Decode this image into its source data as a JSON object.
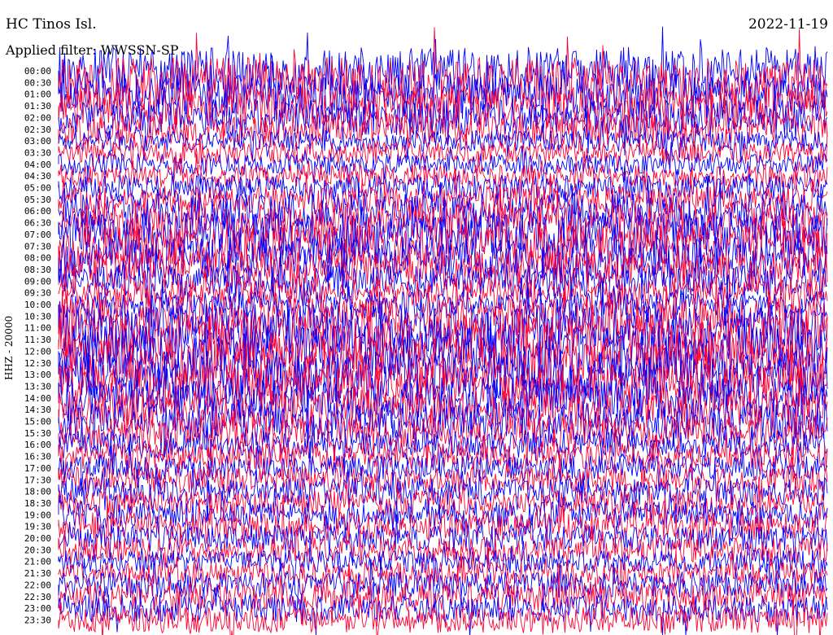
{
  "header": {
    "station": "HC Tinos Isl.",
    "date": "2022-11-19",
    "filter": "Applied filter: WWSSN-SP"
  },
  "channel_label": "HHZ - 20000",
  "colors": {
    "trace_a": "#0000ff",
    "trace_b": "#ff0033",
    "background": "#ffffff"
  },
  "chart_data": {
    "type": "line",
    "title": "HC Tinos Isl.",
    "ylabel": "HHZ - 20000",
    "row_labels": [
      "00:00",
      "00:30",
      "01:00",
      "01:30",
      "02:00",
      "02:30",
      "03:00",
      "03:30",
      "04:00",
      "04:30",
      "05:00",
      "05:30",
      "06:00",
      "06:30",
      "07:00",
      "07:30",
      "08:00",
      "08:30",
      "09:00",
      "09:30",
      "10:00",
      "10:30",
      "11:00",
      "11:30",
      "12:00",
      "12:30",
      "13:00",
      "13:30",
      "14:00",
      "14:30",
      "15:00",
      "15:30",
      "16:00",
      "16:30",
      "17:00",
      "17:30",
      "18:00",
      "18:30",
      "19:00",
      "19:30",
      "20:00",
      "20:30",
      "21:00",
      "21:30",
      "22:00",
      "22:30",
      "23:00",
      "23:30"
    ],
    "series": [
      {
        "values": [
          0.55,
          0.6,
          0.45,
          0.4,
          0.35,
          0.3,
          0.12,
          0.14,
          0.13,
          0.15,
          0.18,
          0.22,
          0.35,
          0.45,
          0.5,
          0.48,
          0.45,
          0.4,
          0.3,
          0.22,
          0.2,
          0.4,
          0.55,
          0.6,
          0.62,
          0.6,
          0.55,
          0.5,
          0.45,
          0.42,
          0.38,
          0.3,
          0.22,
          0.2,
          0.18,
          0.2,
          0.22,
          0.2,
          0.22,
          0.24,
          0.2,
          0.18,
          0.15,
          0.16,
          0.2,
          0.24,
          0.22,
          0.2
        ]
      }
    ]
  }
}
